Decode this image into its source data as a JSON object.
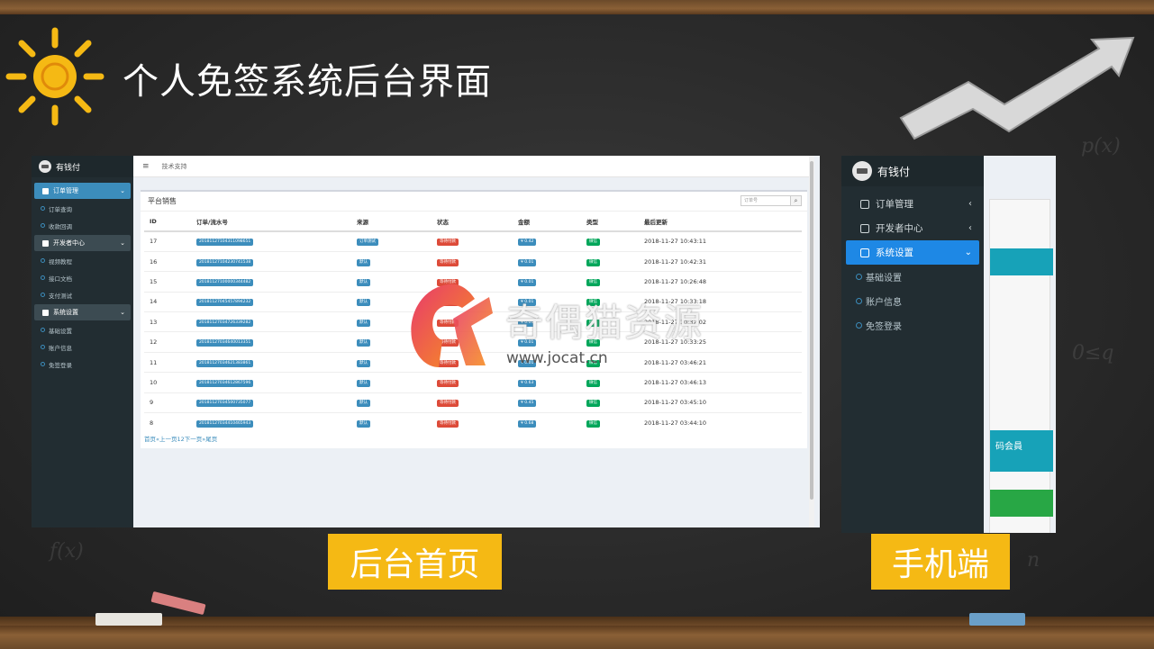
{
  "slide": {
    "title": "个人免签系统后台界面",
    "caption_desktop": "后台首页",
    "caption_mobile": "手机端"
  },
  "desktop": {
    "brand": "有钱付",
    "top_nav_link": "技术支持",
    "sidebar": [
      {
        "label": "订单管理",
        "active": true
      },
      {
        "label": "订单查询"
      },
      {
        "label": "收款回调"
      },
      {
        "label": "开发者中心"
      },
      {
        "label": "视频教程"
      },
      {
        "label": "接口文档"
      },
      {
        "label": "支付测试"
      },
      {
        "label": "系统设置"
      },
      {
        "label": "基础设置"
      },
      {
        "label": "账户信息"
      },
      {
        "label": "免签登录"
      }
    ],
    "box_title": "平台销售",
    "search_placeholder": "订单号",
    "columns": [
      "ID",
      "订单/流水号",
      "来源",
      "状态",
      "金额",
      "类型",
      "最后更新"
    ],
    "rows": [
      {
        "id": "17",
        "order": "20181127104311098651",
        "source": "订单测试",
        "status": "等待付款",
        "amount": "¥ 0.42",
        "type": "微信",
        "updated": "2018-11-27 10:43:11"
      },
      {
        "id": "16",
        "order": "20181127104230741538",
        "source": "默认",
        "status": "等待付款",
        "amount": "¥ 0.01",
        "type": "微信",
        "updated": "2018-11-27 10:42:31"
      },
      {
        "id": "15",
        "order": "20181127100000344482",
        "source": "默认",
        "status": "等待付款",
        "amount": "¥ 0.01",
        "type": "微信",
        "updated": "2018-11-27 10:26:48"
      },
      {
        "id": "14",
        "order": "20181127045457894232",
        "source": "默认",
        "status": "等待付款",
        "amount": "¥ 0.01",
        "type": "微信",
        "updated": "2018-11-27 10:33:18"
      },
      {
        "id": "13",
        "order": "20181127034726339282",
        "source": "默认",
        "status": "等待付款",
        "amount": "¥ 0.01",
        "type": "微信",
        "updated": "2018-11-27 10:32:02"
      },
      {
        "id": "12",
        "order": "20181127034640013351",
        "source": "默认",
        "status": "等待付款",
        "amount": "¥ 0.01",
        "type": "微信",
        "updated": "2018-11-27 10:33:25"
      },
      {
        "id": "11",
        "order": "20181127034621383861",
        "source": "默认",
        "status": "等待付款",
        "amount": "¥ 0.01",
        "type": "微信",
        "updated": "2018-11-27 03:46:21"
      },
      {
        "id": "10",
        "order": "20181127034612867596",
        "source": "默认",
        "status": "等待付款",
        "amount": "¥ 0.63",
        "type": "微信",
        "updated": "2018-11-27 03:46:13"
      },
      {
        "id": "9",
        "order": "20181127034500735077",
        "source": "默认",
        "status": "等待付款",
        "amount": "¥ 0.45",
        "type": "微信",
        "updated": "2018-11-27 03:45:10"
      },
      {
        "id": "8",
        "order": "20181127034410465943",
        "source": "默认",
        "status": "等待付款",
        "amount": "¥ 0.68",
        "type": "微信",
        "updated": "2018-11-27 03:44:10"
      }
    ],
    "pager": "首页«上一页12下一页»尾页"
  },
  "mobile": {
    "brand": "有钱付",
    "menu": [
      {
        "label": "订单管理",
        "chev": "‹"
      },
      {
        "label": "开发者中心",
        "chev": "‹"
      },
      {
        "label": "系统设置",
        "chev": "⌄",
        "active": true
      }
    ],
    "sub": [
      "基础设置",
      "账户信息",
      "免签登录"
    ],
    "teal_text": "码会員"
  },
  "watermark": {
    "name": "奇偶猫资源",
    "url": "www.jocat.cn"
  },
  "colors": {
    "chalkboard": "#2b2b2b",
    "caption_bg": "#f5b914",
    "sidebar": "#222d32",
    "accent_blue": "#3c8dbc",
    "label_red": "#dd4b39",
    "label_green": "#00a65a"
  }
}
